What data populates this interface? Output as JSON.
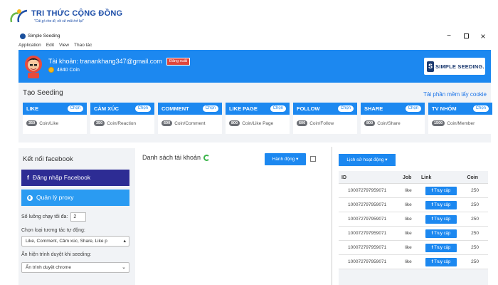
{
  "brand": {
    "name": "TRI THỨC CỘNG ĐỒNG",
    "slogan": "\"Cái gì cho đi, rồi sẽ mãi trở lại\""
  },
  "window": {
    "title": "Simple Seeding",
    "controls": [
      "minimize-icon",
      "maximize-icon",
      "close-icon"
    ]
  },
  "menu": [
    "Application",
    "Edit",
    "View",
    "Thao tác"
  ],
  "account": {
    "label": "Tài khoản: tranankhang347@gmail.com",
    "logout_label": "Đăng xuất",
    "coin": "4840 Coin",
    "logo_letter": "S",
    "logo_text": "SIMPLE SEEDING."
  },
  "seeding": {
    "title": "Tạo Seeding",
    "download_link": "Tải phần mềm lấy cookie",
    "choose_label": "Chọn",
    "cards": [
      {
        "title": "LIKE",
        "price": "350",
        "unit": "Coin/Like"
      },
      {
        "title": "CẢM XÚC",
        "price": "350",
        "unit": "Coin/Reaction"
      },
      {
        "title": "COMMENT",
        "price": "600",
        "unit": "Coin/Comment"
      },
      {
        "title": "LIKE PAGE",
        "price": "800",
        "unit": "Coin/Like Page"
      },
      {
        "title": "FOLLOW",
        "price": "600",
        "unit": "Coin/Follow"
      },
      {
        "title": "SHARE",
        "price": "800",
        "unit": "Coin/Share"
      },
      {
        "title": "TV NHÓM",
        "price": "1500",
        "unit": "Coin/Member"
      }
    ]
  },
  "facebook_panel": {
    "title": "Kết nối facebook",
    "login_button": "Đăng nhập Facebook",
    "proxy_button": "Quản lý proxy",
    "threads_label": "Số luồng chạy tối đa:",
    "threads_value": "2",
    "interaction_label": "Chọn loại tương tác tự động:",
    "interaction_value": "Like, Comment, Cảm xúc, Share, Like p",
    "browser_label": "Ẩn hiện trình duyệt khi seeding:",
    "browser_value": "Ẩn trình duyệt chrome"
  },
  "account_list": {
    "title": "Danh sách tài khoản",
    "action_button": "Hành động",
    "select_all_checked": false
  },
  "history": {
    "button": "Lịch sử hoạt động",
    "columns": [
      "ID",
      "Job",
      "Link",
      "Coin"
    ],
    "visit_label": "Truy cập",
    "rows": [
      {
        "id": "100072797959071",
        "job": "like",
        "coin": "250"
      },
      {
        "id": "100072797959071",
        "job": "like",
        "coin": "250"
      },
      {
        "id": "100072797959071",
        "job": "like",
        "coin": "250"
      },
      {
        "id": "100072797959071",
        "job": "like",
        "coin": "250"
      },
      {
        "id": "100072797959071",
        "job": "like",
        "coin": "250"
      },
      {
        "id": "100072797959071",
        "job": "like",
        "coin": "250"
      }
    ]
  },
  "colors": {
    "primary_blue": "#1c88f0",
    "facebook_navy": "#2d2c94",
    "proxy_blue": "#2a9bf2",
    "logout_red": "#e0463b",
    "coin_gold": "#f5b81c",
    "panel_bg": "#f1f3f6"
  }
}
